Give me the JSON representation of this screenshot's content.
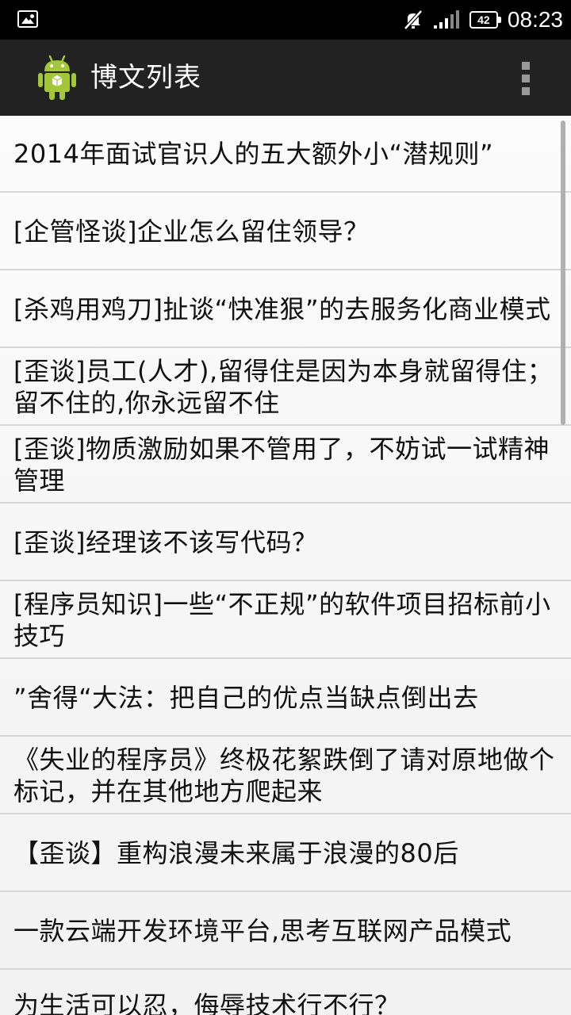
{
  "status_bar": {
    "battery_level": "42",
    "time": "08:23",
    "icons": [
      "image-notification-icon",
      "mute-icon",
      "signal-icon",
      "battery-icon"
    ]
  },
  "action_bar": {
    "title": "博文列表",
    "icon": "android-app-icon",
    "overflow_icon": "overflow-menu-icon"
  },
  "list": {
    "items": [
      {
        "title": "2014年面试官识人的五大额外小“潜规则”"
      },
      {
        "title": "[企管怪谈]企业怎么留住领导？"
      },
      {
        "title": "[杀鸡用鸡刀]扯谈“快准狠”的去服务化商业模式"
      },
      {
        "title": "[歪谈]员工(人才),留得住是因为本身就留得住；留不住的,你永远留不住"
      },
      {
        "title": "[歪谈]物质激励如果不管用了，不妨试一试精神管理"
      },
      {
        "title": "[歪谈]经理该不该写代码？"
      },
      {
        "title": "[程序员知识]一些“不正规”的软件项目招标前小技巧"
      },
      {
        "title": "”舍得“大法：把自己的优点当缺点倒出去"
      },
      {
        "title": "《失业的程序员》终极花絮跌倒了请对原地做个标记，并在其他地方爬起来"
      },
      {
        "title": "【歪谈】重构浪漫未来属于浪漫的80后"
      },
      {
        "title": "一款云端开发环境平台,思考互联网产品模式"
      },
      {
        "title": "为生活可以忍，侮辱技术行不行？"
      }
    ]
  },
  "colors": {
    "status_bar": "#000000",
    "action_bar": "#222222",
    "list_bg": "#f6f6f6",
    "divider": "#d6d6d6",
    "android_green": "#a4c639"
  }
}
